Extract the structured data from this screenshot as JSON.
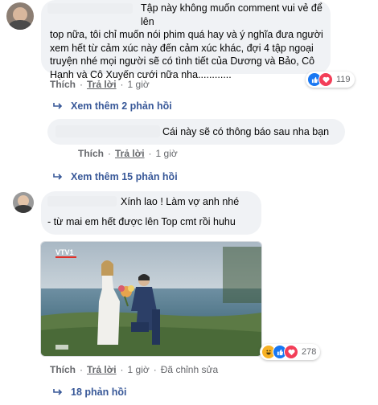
{
  "comments": [
    {
      "text_lines": [
        "Tập này không muốn comment vui vẻ để lên",
        "top nữa, tôi chỉ muốn nói phim quá hay và ý nghĩa đưa người",
        "xem hết từ cảm xúc này đến cảm xúc khác, đợi 4 tập ngoại",
        "truyện nhé mọi người sẽ có tình tiết của Dương và Bảo, Cô",
        "Hạnh và Cô Xuyến cưới nữa nha............"
      ],
      "like": "Thích",
      "reply": "Trả lời",
      "time": "1 giờ",
      "reactions_count": "119",
      "more_replies": "Xem thêm 2 phản hồi"
    }
  ],
  "reply": {
    "text": "Cái này sẽ có thông báo sau nha bạn",
    "like": "Thích",
    "reply": "Trả lời",
    "time": "1 giờ"
  },
  "more_replies_2": "Xem thêm 15 phản hồi",
  "comment2": {
    "line1": "Xính lao ! Làm vợ anh nhé",
    "line2": "- từ mai em hết được lên Top cmt rồi huhu",
    "like": "Thích",
    "reply": "Trả lời",
    "time": "1 giờ",
    "edited": "Đã chỉnh sửa",
    "reactions_count": "278",
    "replies": "18 phản hồi",
    "image_logo": "VTV1"
  },
  "colors": {
    "link_blue": "#385898",
    "like_blue": "#1877f2",
    "love_red": "#f33e58",
    "haha_yellow": "#f7b125"
  }
}
